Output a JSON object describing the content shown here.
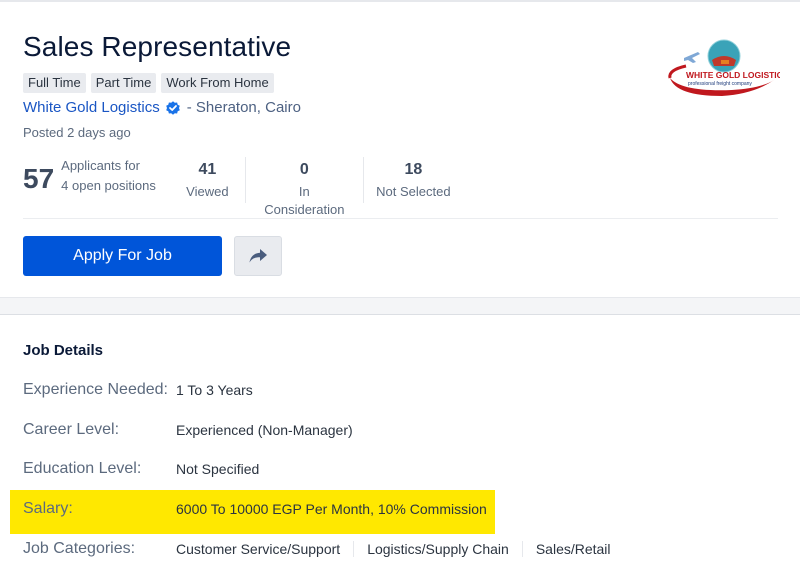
{
  "job": {
    "title": "Sales Representative",
    "tags": [
      "Full Time",
      "Part Time",
      "Work From Home"
    ],
    "company": "White Gold Logistics",
    "company_verified": true,
    "location": "- Sheraton, Cairo",
    "posted": "Posted 2 days ago",
    "logo": {
      "name": "WHITE GOLD LOGISTICS",
      "tagline": "professional freight company"
    }
  },
  "stats": {
    "applicants_count": "57",
    "applicants_label_1": "Applicants for",
    "applicants_label_2": "4 open positions",
    "viewed_count": "41",
    "viewed_label": "Viewed",
    "consideration_count": "0",
    "consideration_label": "In Consideration",
    "not_selected_count": "18",
    "not_selected_label": "Not Selected"
  },
  "actions": {
    "apply_label": "Apply For Job",
    "share_icon": "share-icon"
  },
  "details": {
    "title": "Job Details",
    "experience_label": "Experience Needed:",
    "experience_value": "1 To 3 Years",
    "career_label": "Career Level:",
    "career_value": "Experienced (Non-Manager)",
    "education_label": "Education Level:",
    "education_value": "Not Specified",
    "salary_label": "Salary:",
    "salary_value": "6000 To 10000 EGP Per Month, 10% Commission",
    "categories_label": "Job Categories:",
    "categories": [
      "Customer Service/Support",
      "Logistics/Supply Chain",
      "Sales/Retail"
    ]
  },
  "colors": {
    "brand_blue": "#0055d9",
    "link_blue": "#1a56c4",
    "highlight_yellow": "#ffe800"
  }
}
